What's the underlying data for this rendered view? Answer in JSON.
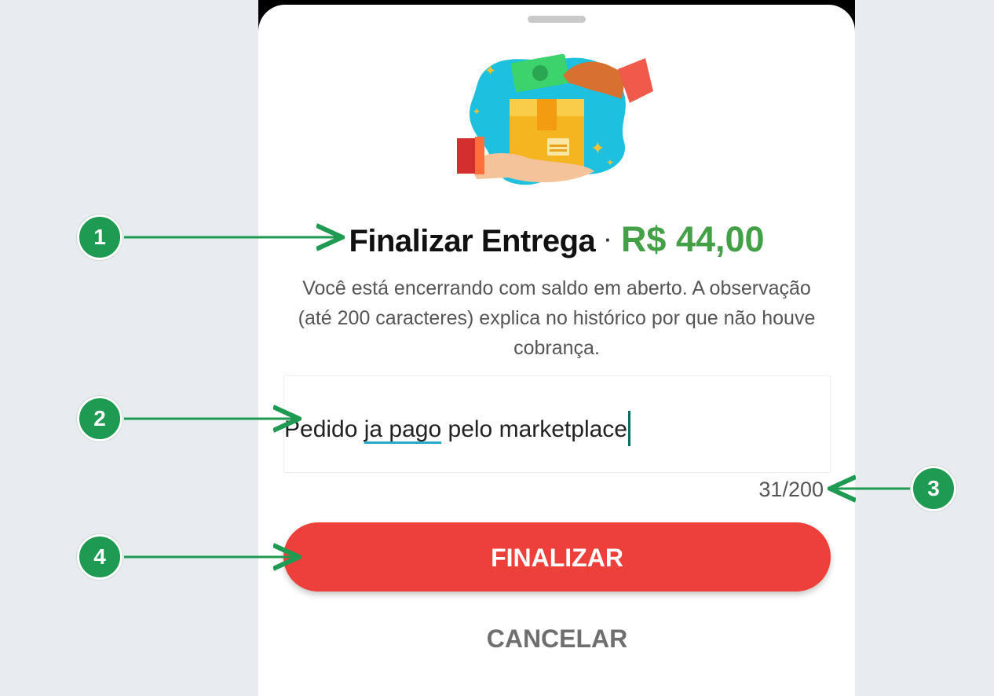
{
  "sheet": {
    "title": "Finalizar Entrega",
    "separator": "·",
    "amount": "R$ 44,00",
    "description": "Você está encerrando com saldo em aberto. A observação (até 200 caracteres) explica no histórico por que não houve cobrança.",
    "note": {
      "part1": "Pedido ",
      "misspelled": "ja pago",
      "part2": " pelo marketplace"
    },
    "counter": "31/200",
    "confirm_label": "FINALIZAR",
    "cancel_label": "CANCELAR"
  },
  "annotations": {
    "badge_1": "1",
    "badge_2": "2",
    "badge_3": "3",
    "badge_4": "4"
  },
  "colors": {
    "amount": "#43a047",
    "primary_button": "#ee403a",
    "badge": "#1e9a52",
    "caret": "#0a6c63",
    "background": "#e8ecf0"
  }
}
